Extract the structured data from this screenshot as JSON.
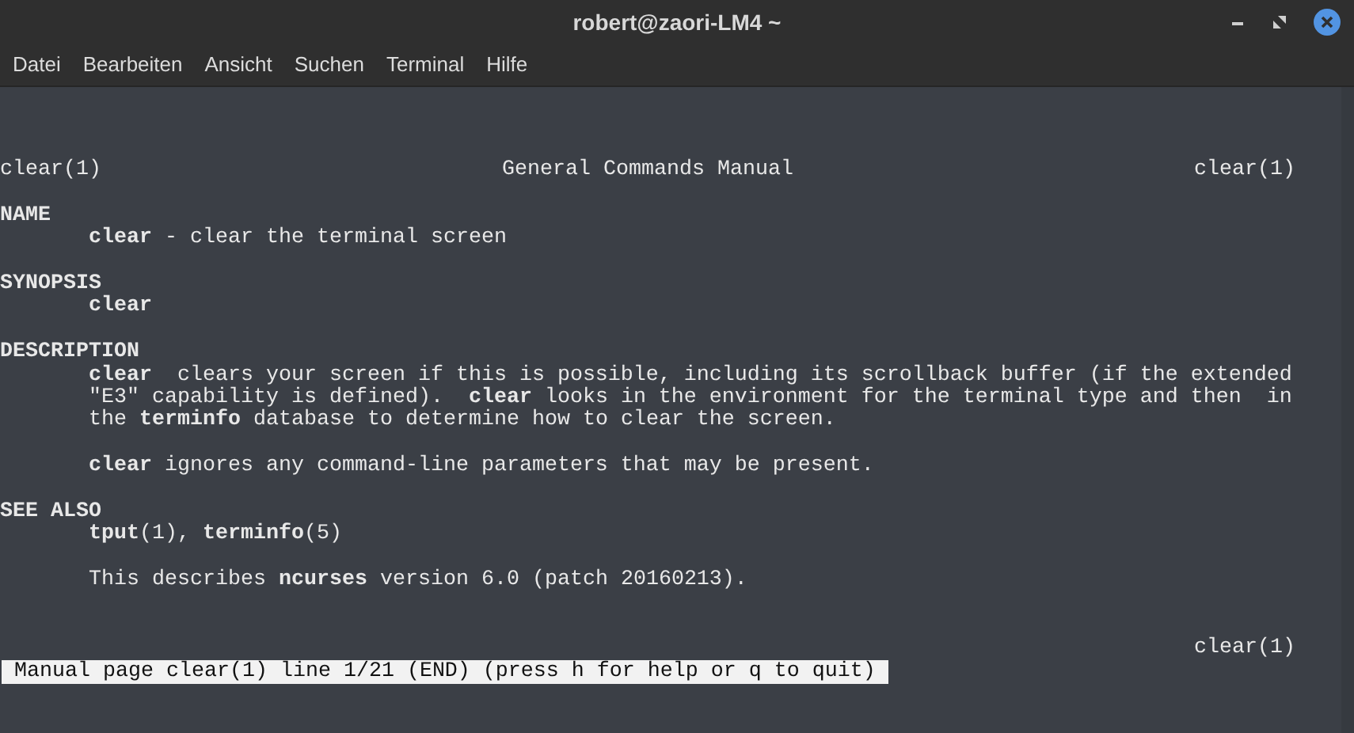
{
  "window": {
    "title": "robert@zaori-LM4 ~"
  },
  "menu": [
    "Datei",
    "Bearbeiten",
    "Ansicht",
    "Suchen",
    "Terminal",
    "Hilfe"
  ],
  "header": {
    "left": "clear(1)",
    "center": "General Commands Manual",
    "right": "clear(1)"
  },
  "lines": [
    {
      "kind": "blank"
    },
    {
      "kind": "heading",
      "text": "NAME"
    },
    {
      "kind": "body",
      "text": "**clear** - clear the terminal screen"
    },
    {
      "kind": "blank"
    },
    {
      "kind": "heading",
      "text": "SYNOPSIS"
    },
    {
      "kind": "body",
      "text": "**clear**"
    },
    {
      "kind": "blank"
    },
    {
      "kind": "heading",
      "text": "DESCRIPTION"
    },
    {
      "kind": "body",
      "text": "**clear**  clears your screen if this is possible, including its scrollback buffer (if the extended"
    },
    {
      "kind": "body",
      "text": "\"E3\" capability is defined).  **clear** looks in the environment for the terminal type and then  in"
    },
    {
      "kind": "body",
      "text": "the **terminfo** database to determine how to clear the screen."
    },
    {
      "kind": "blank"
    },
    {
      "kind": "body",
      "text": "**clear** ignores any command-line parameters that may be present."
    },
    {
      "kind": "blank"
    },
    {
      "kind": "heading",
      "text": "SEE ALSO"
    },
    {
      "kind": "body",
      "text": "**tput**(1), **terminfo**(5)"
    },
    {
      "kind": "blank"
    },
    {
      "kind": "body",
      "text": "This describes **ncurses** version 6.0 (patch 20160213)."
    },
    {
      "kind": "blank"
    },
    {
      "kind": "blank"
    }
  ],
  "footer": {
    "right": "clear(1)"
  },
  "status_line": " Manual page clear(1) line 1/21 (END) (press h for help or q to quit) "
}
